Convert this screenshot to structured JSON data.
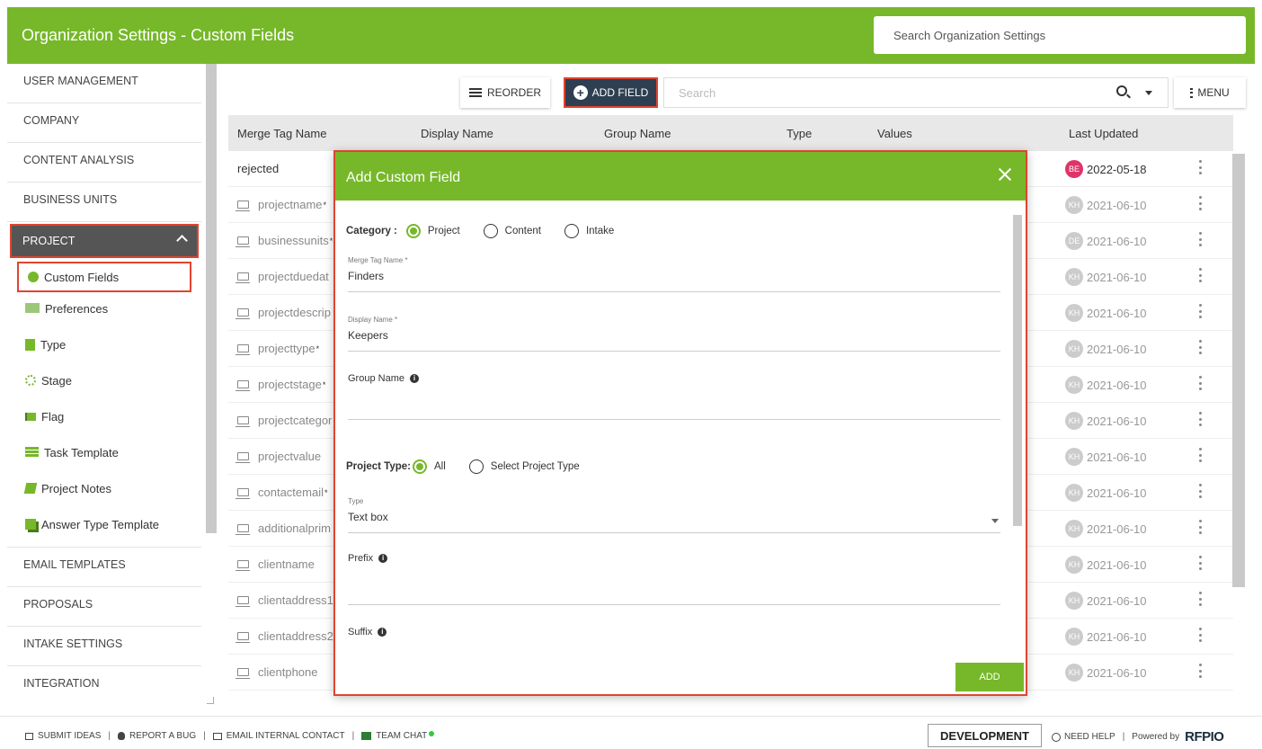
{
  "header": {
    "title": "Organization Settings - Custom Fields",
    "search_placeholder": "Search Organization Settings"
  },
  "sidebar": {
    "items_top": [
      "USER MANAGEMENT",
      "COMPANY",
      "CONTENT ANALYSIS",
      "BUSINESS UNITS"
    ],
    "active": "PROJECT",
    "sub_items": [
      {
        "label": "Custom Fields",
        "icon": "gear-icon"
      },
      {
        "label": "Preferences",
        "icon": "preferences-icon"
      },
      {
        "label": "Type",
        "icon": "document-icon"
      },
      {
        "label": "Stage",
        "icon": "spinner-icon"
      },
      {
        "label": "Flag",
        "icon": "flag-icon"
      },
      {
        "label": "Task Template",
        "icon": "list-icon"
      },
      {
        "label": "Project Notes",
        "icon": "notes-icon"
      },
      {
        "label": "Answer Type Template",
        "icon": "copy-icon"
      }
    ],
    "items_bottom": [
      "EMAIL TEMPLATES",
      "PROPOSALS",
      "INTAKE SETTINGS",
      "INTEGRATION"
    ]
  },
  "toolbar": {
    "reorder_label": "REORDER",
    "add_field_label": "ADD FIELD",
    "search_placeholder": "Search",
    "menu_label": "MENU"
  },
  "table": {
    "columns": [
      "Merge Tag Name",
      "Display Name",
      "Group Name",
      "Type",
      "Values",
      "Last Updated"
    ],
    "rows": [
      {
        "name": "rejected",
        "req": "",
        "avatar": "BE",
        "date": "2022-05-18"
      },
      {
        "name": "projectname",
        "req": "*",
        "avatar": "KH",
        "date": "2021-06-10"
      },
      {
        "name": "businessunits",
        "req": "*",
        "avatar": "DE",
        "date": "2021-06-10"
      },
      {
        "name": "projectduedat",
        "req": "",
        "avatar": "KH",
        "date": "2021-06-10"
      },
      {
        "name": "projectdescrip",
        "req": "",
        "avatar": "KH",
        "date": "2021-06-10"
      },
      {
        "name": "projecttype",
        "req": "*",
        "avatar": "KH",
        "date": "2021-06-10"
      },
      {
        "name": "projectstage",
        "req": "*",
        "avatar": "KH",
        "date": "2021-06-10"
      },
      {
        "name": "projectcategor",
        "req": "",
        "avatar": "KH",
        "date": "2021-06-10"
      },
      {
        "name": "projectvalue",
        "req": "",
        "avatar": "KH",
        "date": "2021-06-10"
      },
      {
        "name": "contactemail",
        "req": "*",
        "avatar": "KH",
        "date": "2021-06-10"
      },
      {
        "name": "additionalprim",
        "req": "",
        "avatar": "KH",
        "date": "2021-06-10"
      },
      {
        "name": "clientname",
        "req": "",
        "avatar": "KH",
        "date": "2021-06-10"
      },
      {
        "name": "clientaddress1",
        "req": "",
        "avatar": "KH",
        "date": "2021-06-10"
      },
      {
        "name": "clientaddress2",
        "req": "",
        "avatar": "KH",
        "date": "2021-06-10"
      },
      {
        "name": "clientphone",
        "req": "",
        "avatar": "KH",
        "date": "2021-06-10"
      }
    ]
  },
  "modal": {
    "title": "Add Custom Field",
    "category_label": "Category :",
    "category_options": [
      "Project",
      "Content",
      "Intake"
    ],
    "merge_tag_label": "Merge Tag Name *",
    "merge_tag_value": "Finders",
    "display_name_label": "Display Name *",
    "display_name_value": "Keepers",
    "group_name_label": "Group Name",
    "project_type_label": "Project Type:",
    "project_type_options": [
      "All",
      "Select Project Type"
    ],
    "type_label": "Type",
    "type_value": "Text box",
    "prefix_label": "Prefix",
    "suffix_label": "Suffix",
    "add_label": "ADD"
  },
  "footer": {
    "links": [
      "SUBMIT IDEAS",
      "REPORT A BUG",
      "EMAIL INTERNAL CONTACT",
      "TEAM CHAT"
    ],
    "environment": "DEVELOPMENT",
    "help": "NEED HELP",
    "powered_by": "Powered by",
    "brand": "RFPIO"
  },
  "colors": {
    "brand_green": "#76b82a",
    "highlight_red": "#e0442f",
    "dark_button": "#2e3f52"
  }
}
